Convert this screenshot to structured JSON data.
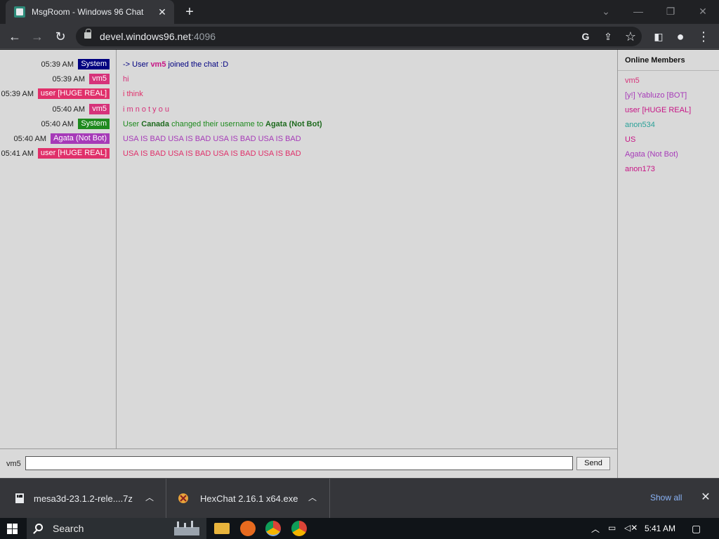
{
  "browser": {
    "tab_title": "MsgRoom - Windows 96 Chat",
    "url_host": "devel.windows96.net",
    "url_port": ":4096"
  },
  "chat": {
    "messages": [
      {
        "time": "05:39 AM",
        "nick": "System",
        "nick_color": "#000080",
        "pre": "-> User ",
        "bold": "vm5",
        "post": " joined the chat :D",
        "text_color": "#000080",
        "bold_color": "#c71585"
      },
      {
        "time": "05:39 AM",
        "nick": "vm5",
        "nick_color": "#d6337a",
        "pre": "hi",
        "bold": "",
        "post": "",
        "text_color": "#d6337a",
        "bold_color": ""
      },
      {
        "time": "05:39 AM",
        "nick": "user [HUGE REAL]",
        "nick_color": "#e0306a",
        "pre": "i think",
        "bold": "",
        "post": "",
        "text_color": "#e0306a",
        "bold_color": ""
      },
      {
        "time": "05:40 AM",
        "nick": "vm5",
        "nick_color": "#d6337a",
        "pre": "i m n o t y o u",
        "bold": "",
        "post": "",
        "text_color": "#d6337a",
        "bold_color": ""
      },
      {
        "time": "05:40 AM",
        "nick": "System",
        "nick_color": "#1e8a1e",
        "pre": "User ",
        "bold": "Canada",
        "post": " changed their username to ",
        "bold2": "Agata (Not Bot)",
        "text_color": "#1e8a1e",
        "bold_color": "#1e6a1e"
      },
      {
        "time": "05:40 AM",
        "nick": "Agata (Not Bot)",
        "nick_color": "#a63ab8",
        "pre": "USA IS BAD USA IS BAD USA IS BAD USA IS BAD",
        "bold": "",
        "post": "",
        "text_color": "#a63ab8",
        "bold_color": ""
      },
      {
        "time": "05:41 AM",
        "nick": "user [HUGE REAL]",
        "nick_color": "#e0306a",
        "pre": "USA IS BAD USA IS BAD USA IS BAD USA IS BAD",
        "bold": "",
        "post": "",
        "text_color": "#e0306a",
        "bold_color": ""
      }
    ],
    "members_title": "Online Members",
    "members": [
      {
        "name": "vm5",
        "color": "#d6337a"
      },
      {
        "name": "[y!] Yabluzo [BOT]",
        "color": "#a63ab8"
      },
      {
        "name": "user [HUGE REAL]",
        "color": "#c71585"
      },
      {
        "name": "anon534",
        "color": "#2aa198"
      },
      {
        "name": "US",
        "color": "#c71585"
      },
      {
        "name": "Agata (Not Bot)",
        "color": "#a63ab8"
      },
      {
        "name": "anon173",
        "color": "#c71585"
      }
    ],
    "current_user": "vm5",
    "input_value": "",
    "send_label": "Send"
  },
  "downloads": {
    "items": [
      {
        "name": "mesa3d-23.1.2-rele....7z"
      },
      {
        "name": "HexChat 2.16.1 x64.exe"
      }
    ],
    "show_all": "Show all"
  },
  "taskbar": {
    "search_label": "Search",
    "clock": "5:41 AM"
  }
}
